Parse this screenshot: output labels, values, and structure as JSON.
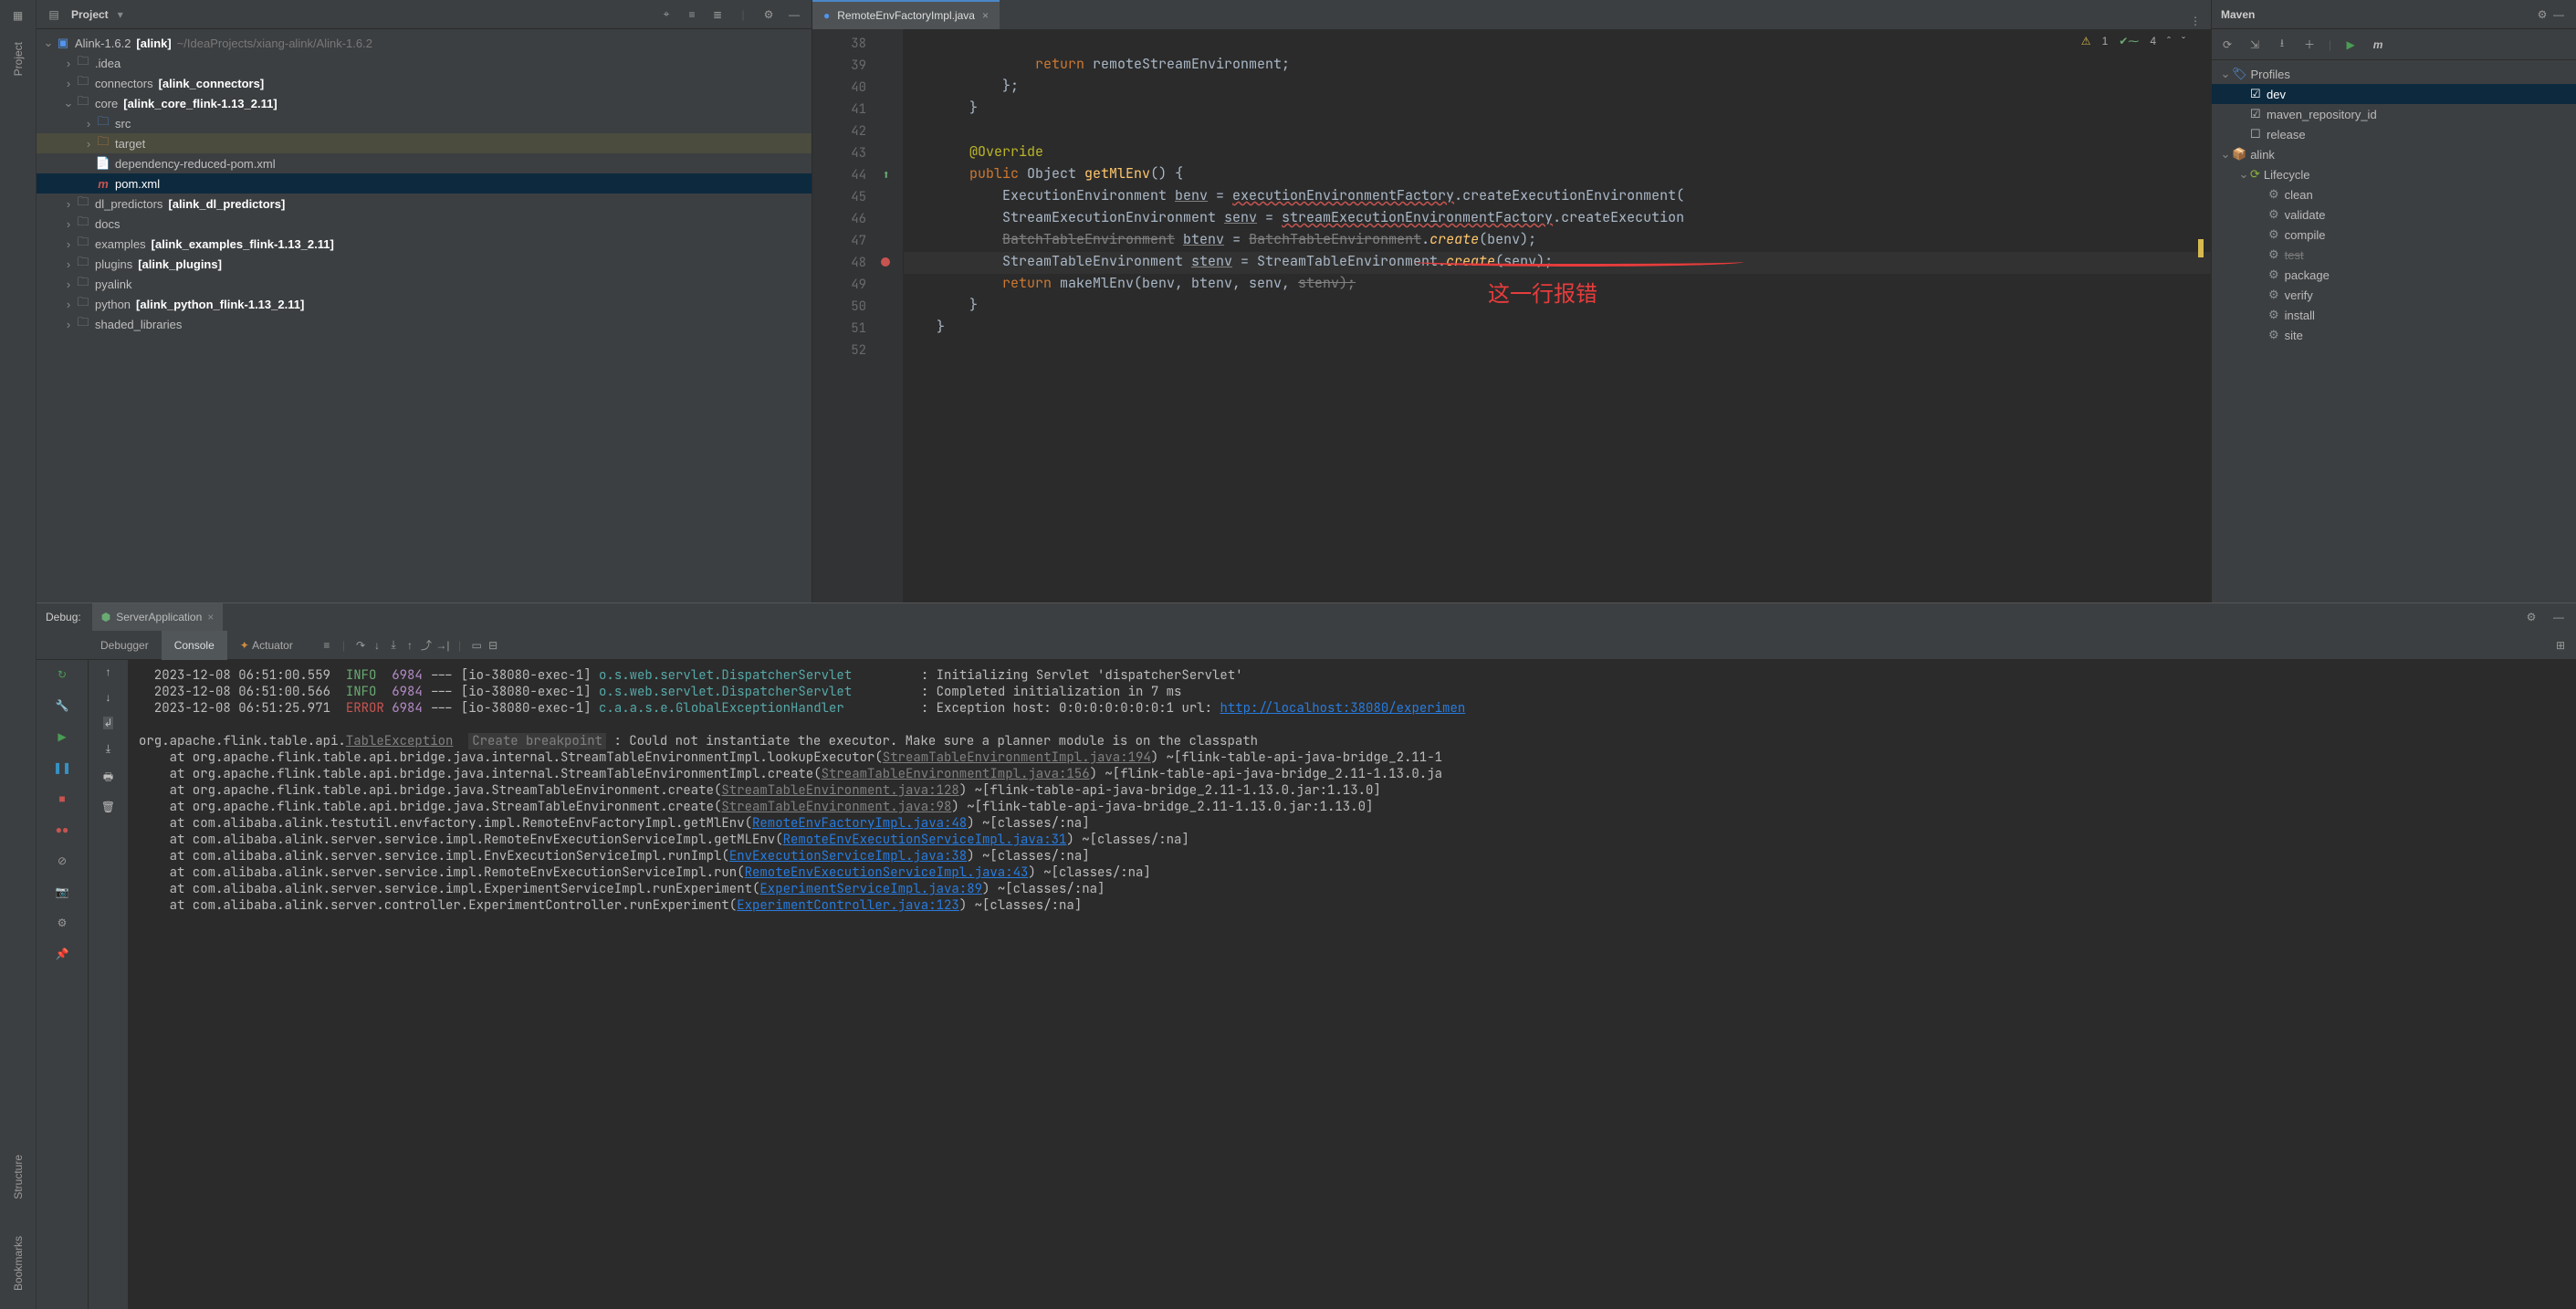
{
  "left_stripe": [
    "Project",
    "Structure",
    "Bookmarks"
  ],
  "project": {
    "title": "Project",
    "root": {
      "name": "Alink-1.6.2",
      "module": "[alink]",
      "path": "~/IdeaProjects/xiang-alink/Alink-1.6.2"
    },
    "items": [
      {
        "indent": 1,
        "arrow": "›",
        "name": ".idea"
      },
      {
        "indent": 1,
        "arrow": "›",
        "name": "connectors",
        "module": "[alink_connectors]"
      },
      {
        "indent": 1,
        "arrow": "⌄",
        "name": "core",
        "module": "[alink_core_flink-1.13_2.11]"
      },
      {
        "indent": 2,
        "arrow": "›",
        "name": "src",
        "folder_style": "blue"
      },
      {
        "indent": 2,
        "arrow": "›",
        "name": "target",
        "folder_style": "orange",
        "highlight": true
      },
      {
        "indent": 2,
        "arrow": "",
        "name": "dependency-reduced-pom.xml",
        "file_icon": "xml"
      },
      {
        "indent": 2,
        "arrow": "",
        "name": "pom.xml",
        "file_icon": "maven",
        "selected": true
      },
      {
        "indent": 1,
        "arrow": "›",
        "name": "dl_predictors",
        "module": "[alink_dl_predictors]"
      },
      {
        "indent": 1,
        "arrow": "›",
        "name": "docs"
      },
      {
        "indent": 1,
        "arrow": "›",
        "name": "examples",
        "module": "[alink_examples_flink-1.13_2.11]"
      },
      {
        "indent": 1,
        "arrow": "›",
        "name": "plugins",
        "module": "[alink_plugins]"
      },
      {
        "indent": 1,
        "arrow": "›",
        "name": "pyalink"
      },
      {
        "indent": 1,
        "arrow": "›",
        "name": "python",
        "module": "[alink_python_flink-1.13_2.11]"
      },
      {
        "indent": 1,
        "arrow": "›",
        "name": "shaded_libraries"
      }
    ]
  },
  "editor": {
    "tab": "RemoteEnvFactoryImpl.java",
    "warn_count": "1",
    "ok_count": "4",
    "gutter_start": 38,
    "gutter_end": 52,
    "marks": {
      "44": "green-up",
      "48": "red-dot"
    },
    "lines": [
      {
        "n": 38,
        "raw": ""
      },
      {
        "n": 39,
        "raw": "                return remoteStreamEnvironment;",
        "tokens": [
          [
            "                ",
            ""
          ],
          [
            "return",
            "kw"
          ],
          [
            " remoteStreamEnvironment;",
            ""
          ]
        ]
      },
      {
        "n": 40,
        "raw": "            };"
      },
      {
        "n": 41,
        "raw": "        }"
      },
      {
        "n": 42,
        "raw": ""
      },
      {
        "n": 43,
        "raw": "        @Override",
        "tokens": [
          [
            "        ",
            ""
          ],
          [
            "@Override",
            "ann"
          ]
        ]
      },
      {
        "n": 44,
        "raw": "        public Object getMlEnv() {",
        "tokens": [
          [
            "        ",
            ""
          ],
          [
            "public",
            "kw"
          ],
          [
            " Object ",
            ""
          ],
          [
            "getMlEnv",
            "fn"
          ],
          [
            "() {",
            ""
          ]
        ]
      },
      {
        "n": 45,
        "tokens": [
          [
            "            ExecutionEnvironment ",
            ""
          ],
          [
            "benv",
            "param-u"
          ],
          [
            " = ",
            ""
          ],
          [
            "executionEnvironmentFactory",
            "call-red"
          ],
          [
            ".createExecutionEnvironment(",
            ""
          ]
        ]
      },
      {
        "n": 46,
        "tokens": [
          [
            "            StreamExecutionEnvironment ",
            ""
          ],
          [
            "senv",
            "param-u"
          ],
          [
            " = ",
            ""
          ],
          [
            "streamExecutionEnvironmentFactory",
            "call-red"
          ],
          [
            ".createExecution",
            ""
          ]
        ]
      },
      {
        "n": 47,
        "tokens": [
          [
            "            ",
            ""
          ],
          [
            "BatchTableEnvironment",
            "strike"
          ],
          [
            " ",
            ""
          ],
          [
            "btenv",
            "param-u"
          ],
          [
            " = ",
            ""
          ],
          [
            "BatchTableEnvironment",
            "strike"
          ],
          [
            ".",
            ""
          ],
          [
            "create",
            "fn-it"
          ],
          [
            "(benv);",
            ""
          ]
        ]
      },
      {
        "n": 48,
        "hl": true,
        "tokens": [
          [
            "            StreamTableEnvironment ",
            ""
          ],
          [
            "stenv",
            "param-u"
          ],
          [
            " = StreamTableEnvironment.",
            ""
          ],
          [
            "create",
            "fn-it"
          ],
          [
            "(senv);",
            ""
          ]
        ]
      },
      {
        "n": 49,
        "tokens": [
          [
            "            ",
            ""
          ],
          [
            "return",
            "kw"
          ],
          [
            " makeMlEnv(benv, btenv, senv, ",
            ""
          ],
          [
            "stenv);",
            "strike"
          ]
        ]
      },
      {
        "n": 50,
        "raw": "        }"
      },
      {
        "n": 51,
        "raw": "    }"
      },
      {
        "n": 52,
        "raw": ""
      }
    ],
    "annotation": "这一行报错"
  },
  "maven": {
    "title": "Maven",
    "toolbar_m": "m",
    "profiles_label": "Profiles",
    "profiles": [
      {
        "checked": true,
        "name": "dev",
        "selected": true
      },
      {
        "checked": true,
        "name": "maven_repository_id"
      },
      {
        "checked": false,
        "name": "release"
      }
    ],
    "module": "alink",
    "lifecycle_label": "Lifecycle",
    "lifecycle": [
      "clean",
      "validate",
      "compile",
      "test",
      "package",
      "verify",
      "install",
      "site"
    ],
    "lifecycle_dim": [
      "test"
    ]
  },
  "debug": {
    "label": "Debug:",
    "run_config": "ServerApplication",
    "subtabs": {
      "debugger": "Debugger",
      "console": "Console",
      "actuator": "Actuator"
    },
    "log_pid": "6984",
    "log_exec": "[io-38080-exec-1]",
    "logs": [
      {
        "ts": "2023-12-08 06:51:00.559",
        "level": "INFO",
        "logger": "o.s.web.servlet.DispatcherServlet",
        "msg": ": Initializing Servlet 'dispatcherServlet'"
      },
      {
        "ts": "2023-12-08 06:51:00.566",
        "level": "INFO",
        "logger": "o.s.web.servlet.DispatcherServlet",
        "msg": ": Completed initialization in 7 ms"
      },
      {
        "ts": "2023-12-08 06:51:25.971",
        "level": "ERROR",
        "logger": "c.a.a.s.e.GlobalExceptionHandler",
        "msg": ": Exception host: 0:0:0:0:0:0:0:1 url: ",
        "link": "http://localhost:38080/experimen"
      }
    ],
    "exception_head": "org.apache.flink.table.api.",
    "exception_cls": "TableException",
    "create_bp": "Create breakpoint",
    "exception_msg": " : Could not instantiate the executor. Make sure a planner module is on the classpath",
    "stack": [
      {
        "pre": "    at org.apache.flink.table.api.bridge.java.internal.StreamTableEnvironmentImpl.lookupExecutor(",
        "link": "StreamTableEnvironmentImpl.java:194",
        "post": ") ~[flink-table-api-java-bridge_2.11-1",
        "dim": true
      },
      {
        "pre": "    at org.apache.flink.table.api.bridge.java.internal.StreamTableEnvironmentImpl.create(",
        "link": "StreamTableEnvironmentImpl.java:156",
        "post": ") ~[flink-table-api-java-bridge_2.11-1.13.0.ja",
        "dim": true
      },
      {
        "pre": "    at org.apache.flink.table.api.bridge.java.StreamTableEnvironment.create(",
        "link": "StreamTableEnvironment.java:128",
        "post": ") ~[flink-table-api-java-bridge_2.11-1.13.0.jar:1.13.0]",
        "dim": true
      },
      {
        "pre": "    at org.apache.flink.table.api.bridge.java.StreamTableEnvironment.create(",
        "link": "StreamTableEnvironment.java:98",
        "post": ") ~[flink-table-api-java-bridge_2.11-1.13.0.jar:1.13.0]",
        "dim": true
      },
      {
        "pre": "    at com.alibaba.alink.testutil.envfactory.impl.RemoteEnvFactoryImpl.getMlEnv(",
        "link": "RemoteEnvFactoryImpl.java:48",
        "post": ") ~[classes/:na]"
      },
      {
        "pre": "    at com.alibaba.alink.server.service.impl.RemoteEnvExecutionServiceImpl.getMLEnv(",
        "link": "RemoteEnvExecutionServiceImpl.java:31",
        "post": ") ~[classes/:na]"
      },
      {
        "pre": "    at com.alibaba.alink.server.service.impl.EnvExecutionServiceImpl.runImpl(",
        "link": "EnvExecutionServiceImpl.java:38",
        "post": ") ~[classes/:na]"
      },
      {
        "pre": "    at com.alibaba.alink.server.service.impl.RemoteEnvExecutionServiceImpl.run(",
        "link": "RemoteEnvExecutionServiceImpl.java:43",
        "post": ") ~[classes/:na]"
      },
      {
        "pre": "    at com.alibaba.alink.server.service.impl.ExperimentServiceImpl.runExperiment(",
        "link": "ExperimentServiceImpl.java:89",
        "post": ") ~[classes/:na]"
      },
      {
        "pre": "    at com.alibaba.alink.server.controller.ExperimentController.runExperiment(",
        "link": "ExperimentController.java:123",
        "post": ") ~[classes/:na]"
      }
    ]
  }
}
